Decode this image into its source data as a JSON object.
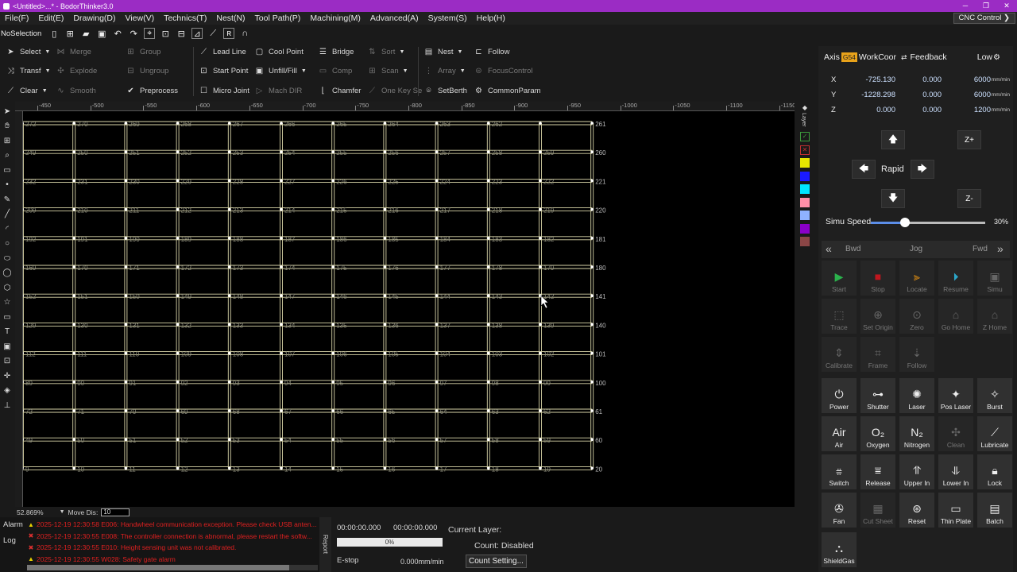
{
  "window": {
    "title": "<Untitled>...* - BodorThinker3.0",
    "controls": [
      "─",
      "❐",
      "✕"
    ]
  },
  "menu": {
    "items": [
      "File(F)",
      "Edit(E)",
      "Drawing(D)",
      "View(V)",
      "Technics(T)",
      "Nest(N)",
      "Tool Path(P)",
      "Machining(M)",
      "Advanced(A)",
      "System(S)",
      "Help(H)"
    ],
    "cnc_control": "CNC Control ❯"
  },
  "quickbar": {
    "selection": "NoSelection"
  },
  "ribbon": {
    "select": "Select",
    "merge": "Merge",
    "group": "Group",
    "lead_line": "Lead Line",
    "cool_point": "Cool Point",
    "bridge": "Bridge",
    "sort": "Sort",
    "nest": "Nest",
    "follow": "Follow",
    "transf": "Transf",
    "explode": "Explode",
    "ungroup": "Ungroup",
    "start_point": "Start Point",
    "unfill_fill": "Unfill/Fill",
    "comp": "Comp",
    "scan": "Scan",
    "array": "Array",
    "focus_control": "FocusControl",
    "clear": "Clear",
    "smooth": "Smooth",
    "preprocess": "Preprocess",
    "micro_joint": "Micro Joint",
    "mach_dir": "Mach DIR",
    "chamfer": "Chamfer",
    "one_key_se": "One Key Se",
    "set_berth": "SetBerth",
    "common_param": "CommonParam"
  },
  "ruler": {
    "h_ticks": [
      "-450",
      "-500",
      "-550",
      "-600",
      "-650",
      "-700",
      "-750",
      "-800",
      "-850",
      "-900",
      "-950",
      "-1000",
      "-1050",
      "-1100",
      "-1150"
    ]
  },
  "chart_data": {
    "type": "grid-nest",
    "columns": 12,
    "rows": 13,
    "row_labels": [
      [
        "272",
        "270",
        "269",
        "268",
        "267",
        "266",
        "265",
        "264",
        "263",
        "262",
        "261"
      ],
      [
        "249",
        "250",
        "251",
        "252",
        "253",
        "254",
        "255",
        "256",
        "257",
        "258",
        "259",
        "260"
      ],
      [
        "232",
        "231",
        "230",
        "229",
        "228",
        "227",
        "226",
        "225",
        "224",
        "223",
        "222",
        "221"
      ],
      [
        "209",
        "210",
        "211",
        "212",
        "213",
        "214",
        "215",
        "216",
        "217",
        "218",
        "219",
        "220"
      ],
      [
        "192",
        "191",
        "190",
        "189",
        "188",
        "187",
        "186",
        "185",
        "184",
        "183",
        "182",
        "181"
      ],
      [
        "169",
        "170",
        "171",
        "172",
        "173",
        "174",
        "175",
        "176",
        "177",
        "178",
        "179",
        "180"
      ],
      [
        "152",
        "151",
        "150",
        "149",
        "148",
        "147",
        "146",
        "145",
        "144",
        "143",
        "142",
        "141"
      ],
      [
        "129",
        "130",
        "131",
        "132",
        "133",
        "134",
        "135",
        "136",
        "137",
        "138",
        "139",
        "140"
      ],
      [
        "112",
        "111",
        "110",
        "109",
        "108",
        "107",
        "106",
        "105",
        "104",
        "103",
        "102",
        "101"
      ],
      [
        "89",
        "90",
        "91",
        "92",
        "93",
        "94",
        "95",
        "96",
        "97",
        "98",
        "99",
        "100"
      ],
      [
        "72",
        "71",
        "70",
        "69",
        "68",
        "67",
        "66",
        "65",
        "64",
        "63",
        "62",
        "61"
      ],
      [
        "49",
        "50",
        "51",
        "52",
        "53",
        "54",
        "55",
        "56",
        "57",
        "58",
        "59",
        "60"
      ],
      [
        "9",
        "10",
        "11",
        "12",
        "13",
        "14",
        "15",
        "16",
        "17",
        "18",
        "19",
        "20"
      ]
    ],
    "line_color": "#d8d4a8",
    "node_color": "#ffffff",
    "label_color": "#8a8a7a"
  },
  "layers": {
    "label": "Layer",
    "colors": [
      "#e6e600",
      "#1a1aff",
      "#00e5ff",
      "#ff8fa8",
      "#8fb2ff",
      "#8a00c8",
      "#8a4646"
    ]
  },
  "status": {
    "zoom": "52.869%",
    "move_dis_label": "Move Dis",
    "move_dis_value": "10"
  },
  "alarms": {
    "tab_alarm": "Alarm",
    "tab_log": "Log",
    "report_tab": "Report",
    "items": [
      {
        "kind": "warn",
        "text": "2025-12-19 12:30:58   E006: Handwheel communication exception. Please check USB anten..."
      },
      {
        "kind": "err",
        "text": "2025-12-19 12:30:55   E008: The controller connection is abnormal, please restart the softw..."
      },
      {
        "kind": "err",
        "text": "2025-12-19 12:30:55   E010: Height sensing unit was not calibrated."
      },
      {
        "kind": "warn",
        "text": "2025-12-19 12:30:55   W028: Safety gate alarm"
      }
    ]
  },
  "process": {
    "time1": "00:00:00.000",
    "time2": "00:00:00.000",
    "progress_pct": "0%",
    "estop": "E-stop",
    "speed": "0.000mm/min",
    "current_layer_label": "Current Layer:",
    "count_label": "Count: Disabled",
    "count_setting": "Count Setting..."
  },
  "axis_panel": {
    "axis": "Axis",
    "badge": "G54",
    "workcoor": "WorkCoor",
    "feedback": "Feedback",
    "speed_mode": "Low",
    "rows": [
      {
        "axis": "X",
        "work": "-725.130",
        "feedback": "0.000",
        "speed": "6000",
        "unit": "mm/min"
      },
      {
        "axis": "Y",
        "work": "-1228.298",
        "feedback": "0.000",
        "speed": "6000",
        "unit": "mm/min"
      },
      {
        "axis": "Z",
        "work": "0.000",
        "feedback": "0.000",
        "speed": "1200",
        "unit": "mm/min"
      }
    ],
    "rapid": "Rapid",
    "zplus": "Z+",
    "zminus": "Z-",
    "simu_speed_label": "Simu Speed",
    "simu_speed_value": "30%",
    "simu_speed_level": 0.3,
    "bwd": "Bwd",
    "jog": "Jog",
    "fwd": "Fwd"
  },
  "functions": [
    {
      "label": "Start",
      "icon": "▶",
      "color": "green",
      "on": false
    },
    {
      "label": "Stop",
      "icon": "■",
      "color": "red",
      "on": false
    },
    {
      "label": "Locate",
      "icon": "⫸",
      "color": "orange",
      "on": false
    },
    {
      "label": "Resume",
      "icon": "⏵",
      "color": "cyan",
      "on": false
    },
    {
      "label": "Simu",
      "icon": "▣",
      "color": "",
      "on": false
    },
    {
      "label": "Trace",
      "icon": "⬚",
      "color": "",
      "on": false
    },
    {
      "label": "Set Origin",
      "icon": "⊕",
      "color": "",
      "on": false
    },
    {
      "label": "Zero",
      "icon": "⊙",
      "color": "",
      "on": false
    },
    {
      "label": "Go Home",
      "icon": "⌂",
      "color": "",
      "on": false
    },
    {
      "label": "Z Home",
      "icon": "⌂",
      "color": "",
      "on": false
    },
    {
      "label": "Calibrate",
      "icon": "⇕",
      "color": "",
      "on": false
    },
    {
      "label": "Frame",
      "icon": "⌗",
      "color": "",
      "on": false
    },
    {
      "label": "Follow",
      "icon": "⇣",
      "color": "",
      "on": false
    },
    {
      "label": "Power",
      "icon": "⏻",
      "color": "",
      "on": true
    },
    {
      "label": "Shutter",
      "icon": "⊶",
      "color": "",
      "on": true
    },
    {
      "label": "Laser",
      "icon": "✺",
      "color": "",
      "on": true
    },
    {
      "label": "Pos Laser",
      "icon": "✦",
      "color": "",
      "on": true
    },
    {
      "label": "Burst",
      "icon": "✧",
      "color": "",
      "on": true
    },
    {
      "label": "Air",
      "icon": "Air",
      "color": "",
      "on": true
    },
    {
      "label": "Oxygen",
      "icon": "O₂",
      "color": "",
      "on": true
    },
    {
      "label": "Nitrogen",
      "icon": "N₂",
      "color": "",
      "on": true
    },
    {
      "label": "Clean",
      "icon": "✣",
      "color": "",
      "on": false
    },
    {
      "label": "Lubricate",
      "icon": "⟋",
      "color": "",
      "on": true
    },
    {
      "label": "Switch",
      "icon": "⩷",
      "color": "",
      "on": true
    },
    {
      "label": "Release",
      "icon": "⩸",
      "color": "",
      "on": true
    },
    {
      "label": "Upper In",
      "icon": "⥣",
      "color": "",
      "on": true
    },
    {
      "label": "Lower In",
      "icon": "⥥",
      "color": "",
      "on": true
    },
    {
      "label": "Lock",
      "icon": "🔒︎",
      "color": "",
      "on": true
    },
    {
      "label": "Fan",
      "icon": "✇",
      "color": "",
      "on": true
    },
    {
      "label": "Cut Sheet",
      "icon": "▦",
      "color": "",
      "on": false
    },
    {
      "label": "Reset",
      "icon": "⊛",
      "color": "",
      "on": true
    },
    {
      "label": "Thin Plate",
      "icon": "▭",
      "color": "",
      "on": true
    },
    {
      "label": "Batch",
      "icon": "▤",
      "color": "",
      "on": true
    },
    {
      "label": "ShieldGas",
      "icon": "⛬",
      "color": "",
      "on": true
    }
  ]
}
